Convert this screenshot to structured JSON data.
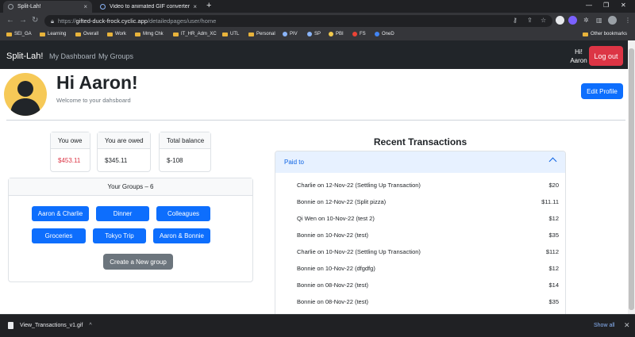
{
  "browser": {
    "tabs": [
      {
        "title": "Split-Lah!"
      },
      {
        "title": "Video to animated GIF converter"
      }
    ],
    "new_tab": "+",
    "url_scheme": "https://",
    "url_host": "gifted-duck-frock.cyclic.app",
    "url_path": "/detailedpages/user/home",
    "bookmarks": [
      "SEI_GA",
      "Learning",
      "Overall",
      "Work",
      "Mmg Chk",
      "IT_HR_Adm_XC",
      "UTL",
      "Personal",
      "PIV",
      "SP",
      "PBI",
      "FS",
      "OneD"
    ],
    "other_bookmarks": "Other bookmarks"
  },
  "navbar": {
    "brand": "Split-Lah!",
    "links": [
      "My Dashboard",
      "My Groups"
    ],
    "greeting_line1": "Hi!",
    "greeting_line2": "Aaron",
    "logout": "Log out"
  },
  "header": {
    "title": "Hi Aaron!",
    "subtitle": "Welcome to your dahsboard",
    "edit_profile": "Edit Profile"
  },
  "stats": [
    {
      "label": "You owe",
      "value": "$453.11",
      "color": "#dc3545"
    },
    {
      "label": "You are owed",
      "value": "$345.11",
      "color": "#212529"
    },
    {
      "label": "Total balance",
      "value": "$-108",
      "color": "#212529"
    }
  ],
  "groups": {
    "header": "Your Groups – 6",
    "items": [
      "Aaron & Charlie",
      "Dinner",
      "Colleagues",
      "Groceries",
      "Tokyo Trip",
      "Aaron & Bonnie"
    ],
    "create": "Create a New group"
  },
  "transactions": {
    "title": "Recent Transactions",
    "section": "Paid to",
    "rows": [
      {
        "desc": "Charlie on 12-Nov-22 (Settling Up Transaction)",
        "amount": "$20"
      },
      {
        "desc": "Bonnie on 12-Nov-22 (Split pizza)",
        "amount": "$11.11"
      },
      {
        "desc": "Qi Wen on 10-Nov-22 (test 2)",
        "amount": "$12"
      },
      {
        "desc": "Bonnie on 10-Nov-22 (test)",
        "amount": "$35"
      },
      {
        "desc": "Charlie on 10-Nov-22 (Settling Up Transaction)",
        "amount": "$112"
      },
      {
        "desc": "Bonnie on 10-Nov-22 (dfgdfg)",
        "amount": "$12"
      },
      {
        "desc": "Bonnie on 08-Nov-22 (test)",
        "amount": "$14"
      },
      {
        "desc": "Bonnie on 08-Nov-22 (test)",
        "amount": "$35"
      }
    ]
  },
  "downloads": {
    "file": "View_Transactions_v1.gif",
    "show_all": "Show all"
  }
}
